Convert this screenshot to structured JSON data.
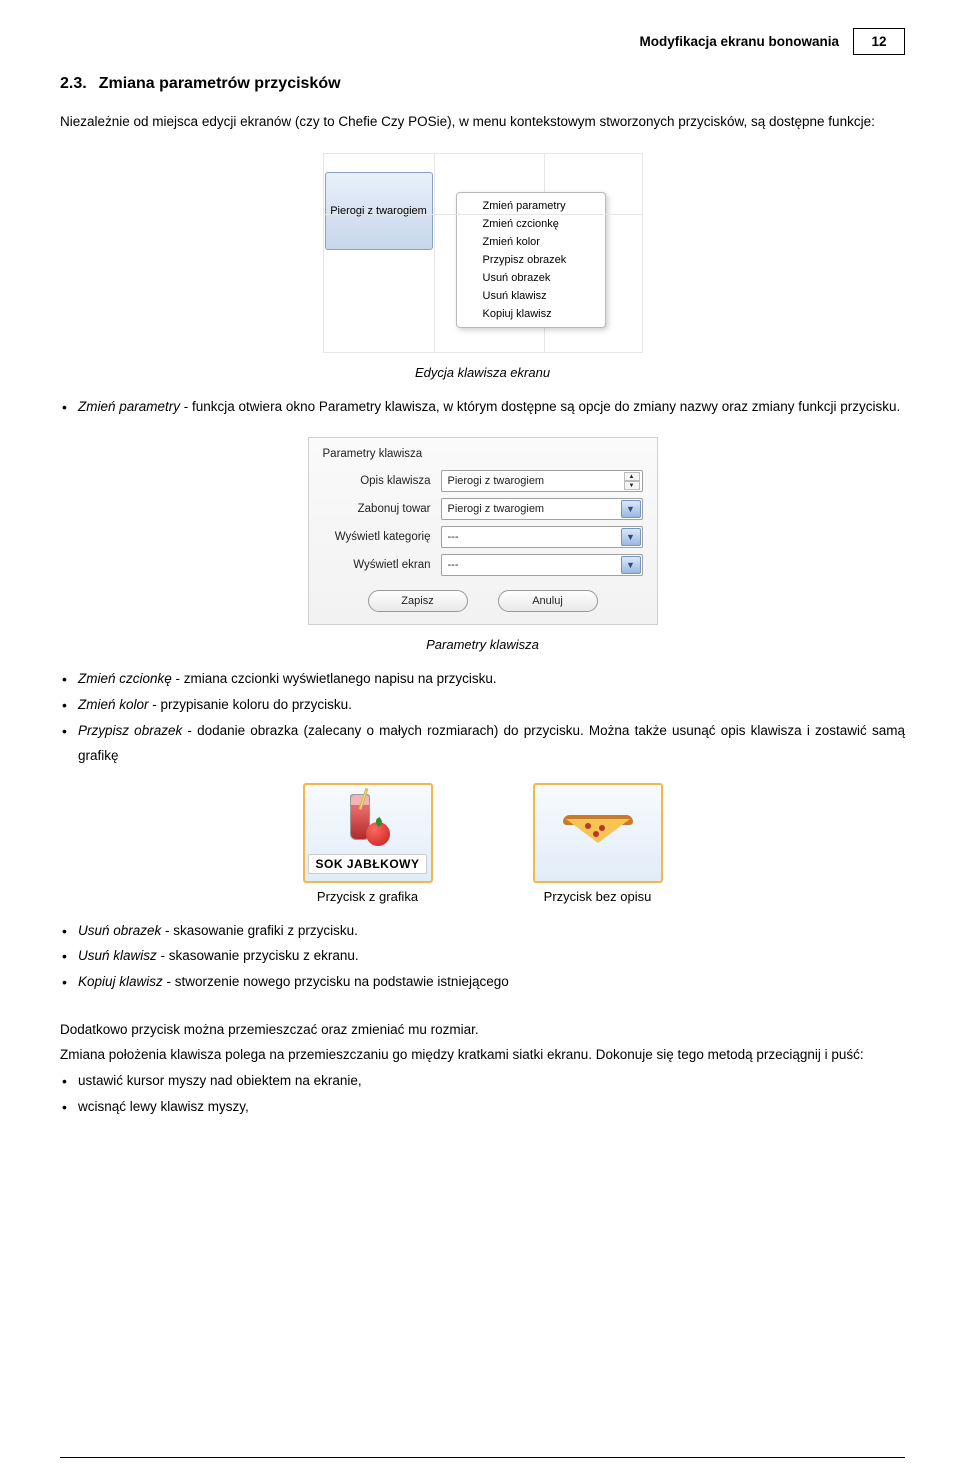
{
  "header": {
    "title": "Modyfikacja ekranu bonowania",
    "page": "12"
  },
  "section": {
    "number": "2.3.",
    "title": "Zmiana parametrów przycisków"
  },
  "intro": "Niezależnie od miejsca edycji ekranów (czy to Chefie Czy POSie), w menu kontekstowym stworzonych przycisków, są dostępne funkcje:",
  "grid_button_label": "Pierogi z twarogiem",
  "context_menu": {
    "items": [
      "Zmień parametry",
      "Zmień czcionkę",
      "Zmień kolor",
      "Przypisz obrazek",
      "Usuń obrazek",
      "Usuń klawisz",
      "Kopiuj klawisz"
    ]
  },
  "caption1": "Edycja klawisza ekranu",
  "para_zmien_parametry_pre": "Zmień parametry",
  "para_zmien_parametry_post": " - funkcja otwiera okno Parametry klawisza, w którym dostępne są opcje do zmiany nazwy oraz zmiany funkcji przycisku.",
  "dialog": {
    "title": "Parametry klawisza",
    "rows": {
      "opis_label": "Opis klawisza",
      "opis_value": "Pierogi z twarogiem",
      "zabonuj_label": "Zabonuj towar",
      "zabonuj_value": "Pierogi z twarogiem",
      "kateg_label": "Wyświetl kategorię",
      "kateg_value": "---",
      "ekran_label": "Wyświetl ekran",
      "ekran_value": "---"
    },
    "buttons": {
      "save": "Zapisz",
      "cancel": "Anuluj"
    }
  },
  "caption2": "Parametry klawisza",
  "bullets2": [
    {
      "name": "Zmień czcionkę",
      "desc": " - zmiana czcionki wyświetlanego napisu na przycisku."
    },
    {
      "name": "Zmień kolor",
      "desc": " - przypisanie koloru do przycisku."
    },
    {
      "name": "Przypisz obrazek",
      "desc": " - dodanie obrazka (zalecany o małych rozmiarach) do przycisku. Można także usunąć opis klawisza i zostawić samą grafikę"
    }
  ],
  "mini": {
    "left_label": "SOK JABŁKOWY",
    "left_caption": "Przycisk z grafika",
    "right_caption": "Przycisk bez opisu"
  },
  "bullets3": [
    {
      "name": "Usuń obrazek",
      "desc": " - skasowanie grafiki z przycisku."
    },
    {
      "name": "Usuń klawisz",
      "desc": " - skasowanie przycisku z ekranu."
    },
    {
      "name": "Kopiuj klawisz",
      "desc": " - stworzenie nowego przycisku na podstawie istniejącego"
    }
  ],
  "tail1": "Dodatkowo przycisk można przemieszczać oraz zmieniać mu rozmiar.",
  "tail2": "Zmiana położenia klawisza polega na przemieszczaniu go między kratkami siatki ekranu. Dokonuje się tego metodą przeciągnij i puść:",
  "tail_steps": [
    "ustawić kursor myszy nad obiektem na ekranie,",
    "wcisnąć lewy klawisz myszy,"
  ]
}
